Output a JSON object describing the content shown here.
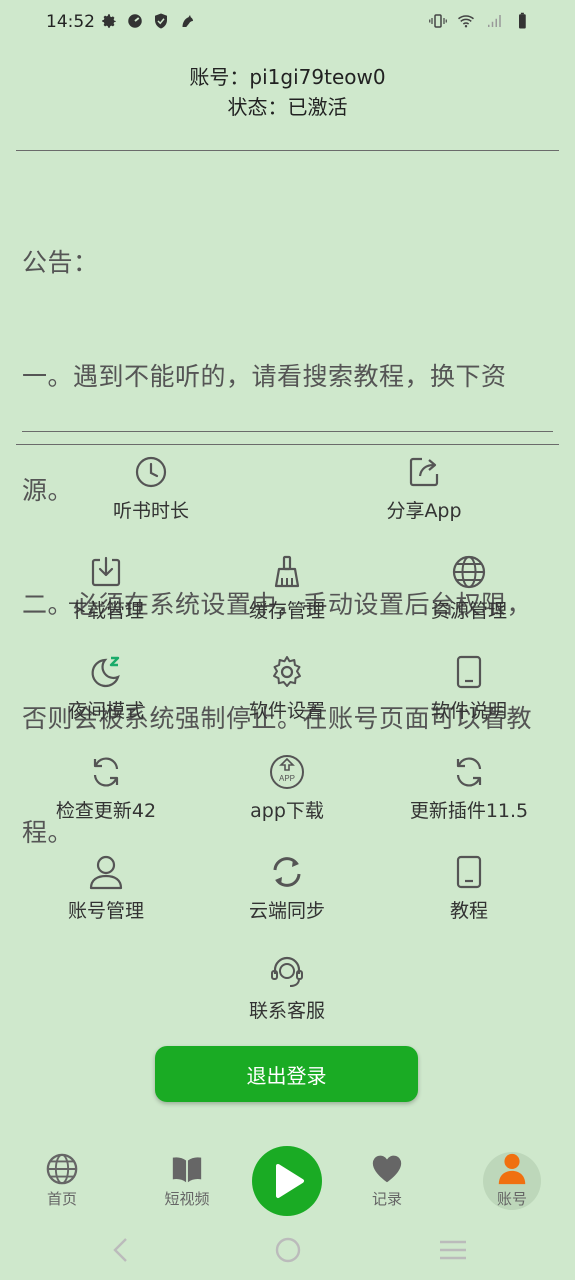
{
  "status_bar": {
    "time": "14:52"
  },
  "account": {
    "id_line": "账号：pi1gi79teow0",
    "status_line": "状态：已激活"
  },
  "notice": {
    "lines": [
      "公告：",
      "一。遇到不能听的，请看搜索教程，换下资",
      "源。",
      "二。必须在系统设置中，手动设置后台权限，",
      "否则会被系统强制停止。在账号页面可以看教",
      "程。"
    ]
  },
  "menu": {
    "listen_time": "听书时长",
    "share_app": "分享App",
    "download_mgmt": "下载管理",
    "cache_mgmt": "缓存管理",
    "source_mgmt": "资源管理",
    "night_mode": "夜间模式",
    "software_settings": "软件设置",
    "software_help": "软件说明",
    "check_update": "检查更新42",
    "app_download": "app下载",
    "update_plugin": "更新插件11.5",
    "account_mgmt": "账号管理",
    "cloud_sync": "云端同步",
    "tutorial": "教程",
    "contact_support": "联系客服"
  },
  "logout_label": "退出登录",
  "bottom_nav": {
    "home": "首页",
    "short_video": "短视频",
    "records": "记录",
    "account": "账号"
  },
  "colors": {
    "background": "#cfe8cc",
    "accent_green": "#1aab24",
    "active_account": "#f07010",
    "night_z": "#1aab6a"
  }
}
